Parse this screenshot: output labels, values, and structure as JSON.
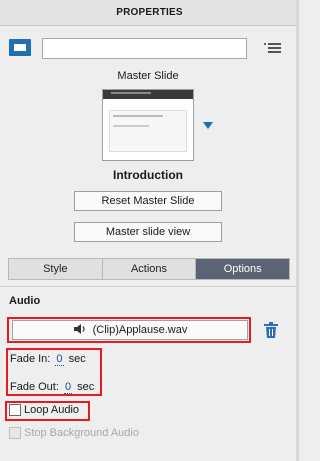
{
  "panel": {
    "title": "PROPERTIES"
  },
  "slide": {
    "name_value": "",
    "master_label": "Master Slide",
    "thumbnail_header": "Double click to add title",
    "master_name": "Introduction"
  },
  "buttons": {
    "reset_master": "Reset Master Slide",
    "master_view": "Master slide view"
  },
  "tabs": [
    {
      "label": "Style",
      "active": false
    },
    {
      "label": "Actions",
      "active": false
    },
    {
      "label": "Options",
      "active": true
    }
  ],
  "audio": {
    "section_title": "Audio",
    "clip_label": "(Clip)Applause.wav",
    "fade_in_label": "Fade In:",
    "fade_in_value": "0",
    "fade_out_label": "Fade Out:",
    "fade_out_value": "0",
    "unit": "sec",
    "loop_label": "Loop Audio",
    "loop_checked": false,
    "stop_bg_label": "Stop Background Audio",
    "stop_bg_enabled": false
  },
  "colors": {
    "accent": "#1f6fb2",
    "active_tab": "#5b6375",
    "highlight": "#e8191f",
    "link_value": "#1f4f9e"
  },
  "icons": [
    "slide-icon",
    "menu-icon",
    "dropdown-arrow-icon",
    "speaker-icon",
    "trash-icon",
    "checkbox-icon"
  ]
}
